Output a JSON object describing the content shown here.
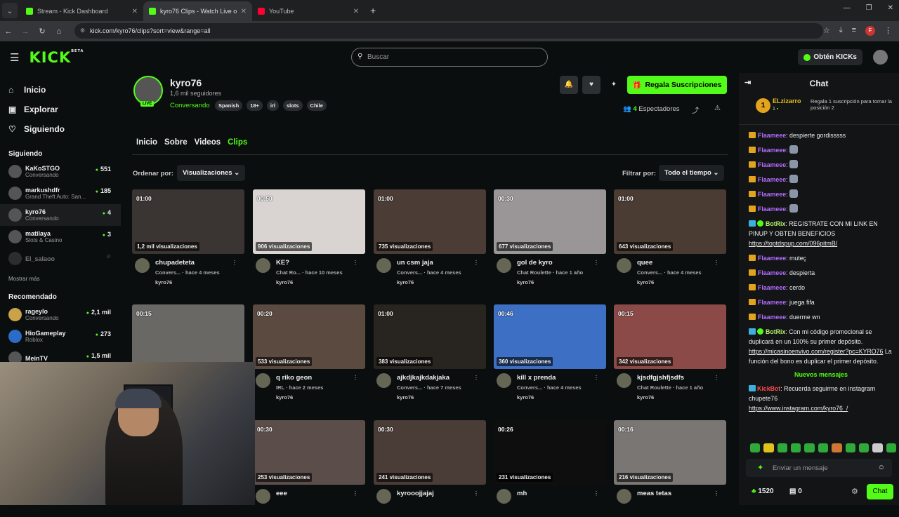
{
  "browser": {
    "tabs": [
      {
        "title": "Stream - Kick Dashboard",
        "color": "#53fc18"
      },
      {
        "title": "kyro76 Clips - Watch Live o",
        "color": "#53fc18"
      },
      {
        "title": "YouTube",
        "color": "#ff0033"
      }
    ],
    "url": "kick.com/kyro76/clips?sort=view&range=all",
    "profile_letter": "F"
  },
  "topbar": {
    "logo": "KICK",
    "logo_beta": "BETA",
    "search_placeholder": "Buscar",
    "kicks_label": "Obtén KICKs"
  },
  "sidebar": {
    "nav": [
      {
        "label": "Inicio",
        "icon": "home-icon"
      },
      {
        "label": "Explorar",
        "icon": "explore-icon"
      },
      {
        "label": "Siguiendo",
        "icon": "heart-icon"
      }
    ],
    "following_title": "Siguiendo",
    "following": [
      {
        "name": "KaKoSTGO",
        "sub": "Conversando",
        "count": "551"
      },
      {
        "name": "markushdfr",
        "sub": "Grand Theft Auto: San...",
        "count": "185"
      },
      {
        "name": "kyro76",
        "sub": "Conversando",
        "count": "4"
      },
      {
        "name": "matilaya",
        "sub": "Slots & Casino",
        "count": "3"
      },
      {
        "name": "El_salaoo",
        "sub": "",
        "count": ""
      }
    ],
    "show_more": "Mostrar más",
    "recommended_title": "Recomendado",
    "recommended": [
      {
        "name": "rageylo",
        "sub": "Conversando",
        "count": "2,1 mil"
      },
      {
        "name": "HioGameplay",
        "sub": "Roblox",
        "count": "273"
      },
      {
        "name": "MeinTV",
        "sub": "",
        "count": "1,5 mil"
      }
    ]
  },
  "channel": {
    "name": "kyro76",
    "live_badge": "LIVE",
    "followers": "1,6 mil seguidores",
    "category": "Conversando",
    "tags": [
      "Spanish",
      "18+",
      "irl",
      "slots",
      "Chile"
    ],
    "subscribe_label": "Regala Suscripciones",
    "viewers_count": "4",
    "viewers_label": "Espectadores",
    "tabs": [
      "Inicio",
      "Sobre",
      "Videos",
      "Clips"
    ],
    "sort_label": "Ordenar por:",
    "sort_value": "Visualizaciones",
    "filter_label": "Filtrar por:",
    "filter_value": "Todo el tiempo"
  },
  "clips": [
    {
      "duration": "01:00",
      "views": "1,2 mil visualizaciones",
      "title": "chupadeteta",
      "cat": "Convers...",
      "age": "hace 4 meses",
      "user": "kyro76",
      "bg": "#3a3432"
    },
    {
      "duration": "00:50",
      "views": "906 visualizaciones",
      "title": "KE?",
      "cat": "Chat Ro...",
      "age": "hace 10 meses",
      "user": "kyro76",
      "bg": "#d9d4d2"
    },
    {
      "duration": "01:00",
      "views": "735 visualizaciones",
      "title": "un csm jaja",
      "cat": "Convers...",
      "age": "hace 4 meses",
      "user": "kyro76",
      "bg": "#4b3c36"
    },
    {
      "duration": "00:30",
      "views": "677 visualizaciones",
      "title": "gol de kyro",
      "cat": "Chat Roulette",
      "age": "hace 1 año",
      "user": "kyro76",
      "bg": "#9a9596"
    },
    {
      "duration": "01:00",
      "views": "643 visualizaciones",
      "title": "quee",
      "cat": "Convers...",
      "age": "hace 4 meses",
      "user": "kyro76",
      "bg": "#4a3b33"
    },
    {
      "duration": "00:15",
      "views": "",
      "title": "",
      "cat": "",
      "age": "",
      "user": "",
      "bg": "#6a6864"
    },
    {
      "duration": "00:20",
      "views": "533 visualizaciones",
      "title": "q riko geon",
      "cat": "IRL",
      "age": "hace 2 meses",
      "user": "kyro76",
      "bg": "#5a4a40"
    },
    {
      "duration": "01:00",
      "views": "383 visualizaciones",
      "title": "ajkdjkajkdakjaka",
      "cat": "Convers...",
      "age": "hace 7 meses",
      "user": "kyro76",
      "bg": "#28241f"
    },
    {
      "duration": "00:46",
      "views": "360 visualizaciones",
      "title": "kill x prenda",
      "cat": "Convers...",
      "age": "hace 4 meses",
      "user": "kyro76",
      "bg": "#3d6fc4"
    },
    {
      "duration": "00:15",
      "views": "342 visualizaciones",
      "title": "kjsdfgjshfjsdfs",
      "cat": "Chat Roulette",
      "age": "hace 1 año",
      "user": "kyro76",
      "bg": "#8b4a48"
    },
    {
      "duration": "00:30",
      "views": "253 visualizaciones",
      "title": "eee",
      "cat": "",
      "age": "",
      "user": "",
      "bg": "#5b4e4a"
    },
    {
      "duration": "00:30",
      "views": "241 visualizaciones",
      "title": "kyrooojjajaj",
      "cat": "",
      "age": "",
      "user": "",
      "bg": "#4a3c36"
    },
    {
      "duration": "00:26",
      "views": "231 visualizaciones",
      "title": "mh",
      "cat": "",
      "age": "",
      "user": "",
      "bg": "#0e0e0e"
    },
    {
      "duration": "00:16",
      "views": "216 visualizaciones",
      "title": "meas tetas",
      "cat": "",
      "age": "",
      "user": "",
      "bg": "#7a7674"
    }
  ],
  "chat": {
    "title": "Chat",
    "pinned_user": "ELzizarro",
    "pinned_rank": "1",
    "pinned_sub": "1",
    "pinned_msg": "Regala 1 suscripción para tomar la posición 2",
    "messages": [
      {
        "user": "Flaameee",
        "text": ": despierte gordisssss",
        "type": "user"
      },
      {
        "user": "Flaameee",
        "text": ":",
        "type": "user"
      },
      {
        "user": "Flaameee",
        "text": ":",
        "type": "user"
      },
      {
        "user": "Flaameee",
        "text": ":",
        "type": "user"
      },
      {
        "user": "Flaameee",
        "text": ":",
        "type": "user"
      },
      {
        "user": "Flaameee",
        "text": ":",
        "type": "user"
      },
      {
        "user": "BotRix",
        "text": ": REGISTRATE CON MI LINK EN PINUP Y OBTEN BENEFICIOS",
        "link": "https://toptdspup.com/096pitmB/",
        "type": "bot"
      },
      {
        "user": "Flaameee",
        "text": ": muteç",
        "type": "user"
      },
      {
        "user": "Flaameee",
        "text": ": despierta",
        "type": "user"
      },
      {
        "user": "Flaameee",
        "text": ": cerdo",
        "type": "user"
      },
      {
        "user": "Flaameee",
        "text": ": juega fifa",
        "type": "user"
      },
      {
        "user": "Flaameee",
        "text": ": duerme wn",
        "type": "user"
      },
      {
        "user": "BotRix",
        "text": ": Con mi código promocional se duplicará en un 100% su primer depósito.",
        "link": "https://micasinoenvivo.com/register?pc=KYRO76",
        "tail": " La función del bono es duplicar el primer depósito.",
        "type": "bot"
      }
    ],
    "new_messages": "Nuevos mensajes",
    "kickbot": {
      "user": "KickBot",
      "text": ": Recuerda seguirme en instagram chupete76",
      "link": "https://www.instagram.com/kyro76_/"
    },
    "input_placeholder": "Enviar un mensaje",
    "points": "1520",
    "points2": "0",
    "send_label": "Chat"
  }
}
